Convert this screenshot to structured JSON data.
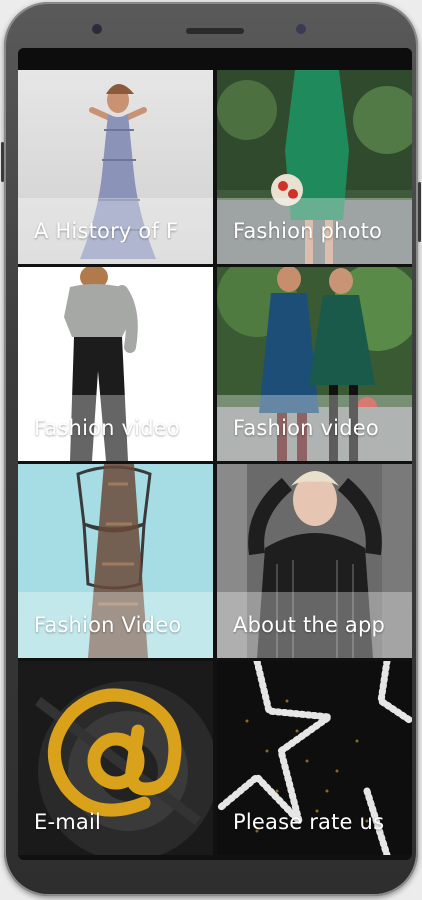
{
  "tiles": [
    {
      "label": "A History of F",
      "icon": "dress-photo"
    },
    {
      "label": "Fashion photo",
      "icon": "green-dress-photo"
    },
    {
      "label": "Fashion video",
      "icon": "back-view-photo"
    },
    {
      "label": "Fashion video",
      "icon": "two-models-photo"
    },
    {
      "label": "Fashion Video",
      "icon": "mannequin-photo"
    },
    {
      "label": "About the app",
      "icon": "portrait-photo"
    },
    {
      "label": "E-mail",
      "icon": "at-sign-icon"
    },
    {
      "label": "Please rate us",
      "icon": "star-lights-photo"
    }
  ],
  "colors": {
    "caption_overlay": "rgba(255,255,255,0.32)",
    "at_gold": "#d9a21a"
  }
}
